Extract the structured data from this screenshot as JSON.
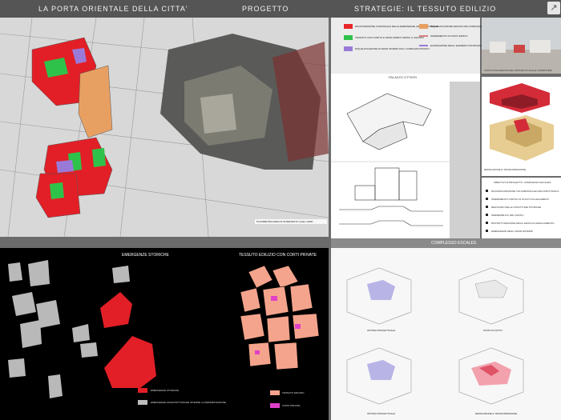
{
  "header": {
    "title": "LA PORTA ORIENTALE DELLA CITTA'",
    "section": "PROGETTO",
    "strategy": "STRATEGIE: IL TESSUTO EDILIZIO"
  },
  "nav": {
    "icon": "expand-arrow-icon"
  },
  "legend_top": {
    "items": [
      {
        "color": "#e8272b",
        "text": "RICONVERSIONE FUNZIONALE DELLE EMERGENZE ARCHITETTONICHE"
      },
      {
        "color": "#2fc24a",
        "text": "TESSUTO CON CORTILI E SPAZI APERTI VERSO IL CENTRO"
      },
      {
        "color": "#9a7ad8",
        "text": "RIQUALIFICAZIONE DI SPAZI INTERNI TRA I COMPLESSI PRIVATI"
      },
      {
        "color": "#e8a062",
        "text": "RIQUALIFICAZIONE EDILIZIA DEI COMPLESSI"
      },
      {
        "color": "#d98080",
        "text": "INSERIMENTO DI NUOVI EDIFICI"
      },
      {
        "color": "#9a7ad8",
        "text": "ELIMINAZIONE DEGLI ELEMENTI INCONGRUI"
      }
    ]
  },
  "map": {
    "caption": "PLANIMETRIA AREA DI INTERVENTO   scala 1:2000"
  },
  "photo": {
    "caption": "VISTA FOTOGRAFICA DEL PROGETTO DALLE COPERTURE"
  },
  "palazzo": {
    "title": "PALAZZO OTTIERI"
  },
  "model": {
    "caption": "DEMOLIZIONE E TRASFORMAZIONE"
  },
  "objectives": {
    "title": "OBIETTIVI DI PROGETTO: COMPLESSO ESCALES",
    "items": [
      "RICONFIGURAZIONE VOLUMETRICA ED ARCHITETTONICA",
      "INSERIMENTO CORTILI DI NUOVI COLLEGAMENTI",
      "RESTAURO DELLE STRUTTURE STORICHE",
      "PERMEABILITA' DEI CORTILI",
      "RISTRUTTURAZIONE DEGLI EDIFICI E ADEGUAMENTO",
      "EMERGENZE DEGLI SPAZI ESTERNI"
    ]
  },
  "complesso": {
    "title": "COMPLESSO ESCALES"
  },
  "emergenze": {
    "title": "EMERGENZE STORICHE",
    "legend": [
      {
        "color": "#e8272b",
        "text": "EMERGENZE STORICHE"
      },
      {
        "color": "#bdbdbd",
        "text": "EMERGENZE ARCHITETTONICHE INTERNE LA PERIMETRAZIONE"
      }
    ]
  },
  "tessuto": {
    "title": "TESSUTO EDILIZIO CON CORTI PRIVATE",
    "legend": [
      {
        "color": "#f4a48c",
        "text": "TESSUTO EDILIZIO"
      },
      {
        "color": "#e040c8",
        "text": "CORTI PRIVATE"
      }
    ]
  },
  "axon": {
    "captions": [
      "IPOTESI PROGETTUALE",
      "STATO DI FATTO",
      "IPOTESI PROGETTUALE",
      "DEMOLIZIONE E TRASFORMAZIONE"
    ]
  }
}
